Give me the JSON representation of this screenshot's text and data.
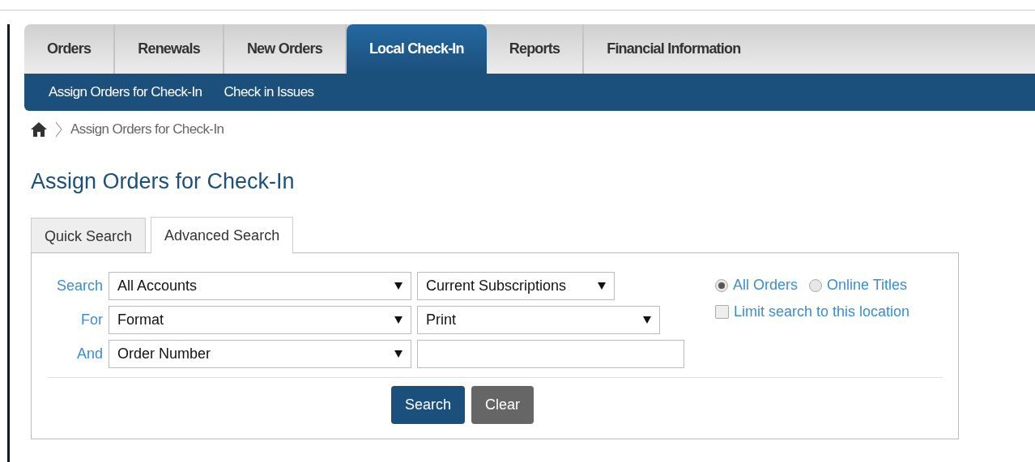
{
  "main_tabs": [
    {
      "label": "Orders",
      "selected": false
    },
    {
      "label": "Renewals",
      "selected": false
    },
    {
      "label": "New Orders",
      "selected": false
    },
    {
      "label": "Local Check-In",
      "selected": true
    },
    {
      "label": "Reports",
      "selected": false
    },
    {
      "label": "Financial Information",
      "selected": false
    }
  ],
  "sub_nav": [
    "Assign Orders for Check-In",
    "Check in Issues"
  ],
  "breadcrumb": [
    "Assign Orders for Check-In"
  ],
  "page_title": "Assign Orders for Check-In",
  "search_tabs": [
    {
      "label": "Quick Search",
      "selected": false
    },
    {
      "label": "Advanced Search",
      "selected": true
    }
  ],
  "criteria": [
    {
      "label": "Search",
      "field": {
        "kind": "select",
        "value": "All Accounts"
      },
      "second": {
        "kind": "select",
        "value": "Current Subscriptions"
      }
    },
    {
      "label": "For",
      "field": {
        "kind": "select",
        "value": "Format"
      },
      "second": {
        "kind": "select",
        "value": "Print"
      }
    },
    {
      "label": "And",
      "field": {
        "kind": "select",
        "value": "Order Number"
      },
      "second": {
        "kind": "input"
      }
    }
  ],
  "scope": [
    {
      "label": "All Orders",
      "selected": true
    },
    {
      "label": "Online Titles",
      "selected": false
    }
  ],
  "limit_location": {
    "label": "Limit search to this location",
    "checked": false
  },
  "buttons": [
    {
      "label": "Search",
      "kind": "primary"
    },
    {
      "label": "Clear",
      "kind": "secondary"
    }
  ]
}
